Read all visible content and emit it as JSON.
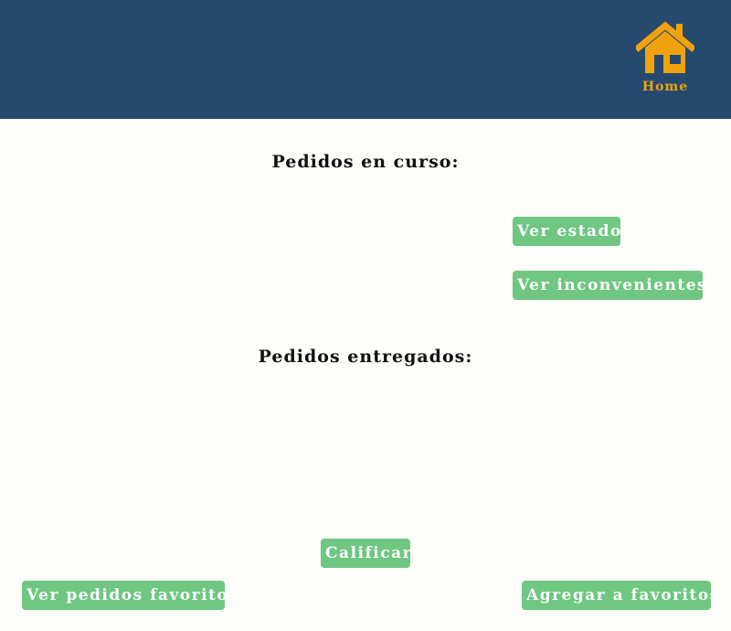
{
  "header": {
    "home_label": "Home",
    "home_icon": "house-icon",
    "background_color": "#264a6e",
    "accent_color": "#f0a20e"
  },
  "sections": {
    "en_curso_title": "Pedidos en curso:",
    "entregados_title": "Pedidos entregados:"
  },
  "buttons": {
    "ver_estado": "Ver estado",
    "ver_inconvenientes": "Ver inconvenientes",
    "calificar": "Calificar",
    "ver_pedidos_favoritos": "Ver pedidos favoritos",
    "agregar_a_favoritos": "Agregar a favoritos",
    "color": "#6fc781"
  }
}
